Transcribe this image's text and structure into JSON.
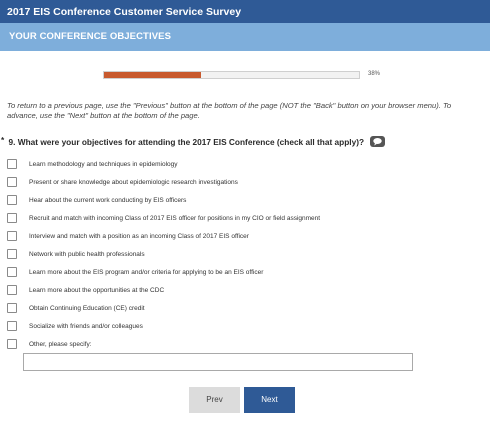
{
  "survey": {
    "title": "2017 EIS Conference Customer Service Survey",
    "page_title": "YOUR CONFERENCE OBJECTIVES"
  },
  "progress": {
    "percent": 38,
    "label": "38%",
    "fill_color": "#c85a2e"
  },
  "instructions": "To return to a previous page, use the \"Previous\" button at the bottom of the page (NOT the \"Back\" button on your browser menu). To advance, use the \"Next\" button at the bottom of the page.",
  "question": {
    "required_marker": "*",
    "text": "9. What were your objectives for attending the 2017 EIS Conference (check all that apply)?",
    "icon": "comment-icon",
    "options": [
      {
        "label": "Learn methodology and techniques in epidemiology",
        "checked": false
      },
      {
        "label": "Present or share knowledge about epidemiologic research investigations",
        "checked": false
      },
      {
        "label": "Hear about the current work conducting by EIS officers",
        "checked": false
      },
      {
        "label": "Recruit and match with incoming Class of 2017 EIS officer for positions in my CIO or field assignment",
        "checked": false
      },
      {
        "label": "Interview and match with a position as an incoming Class of 2017 EIS officer",
        "checked": false
      },
      {
        "label": "Network with public health professionals",
        "checked": false
      },
      {
        "label": "Learn more about the EIS program and/or criteria for applying to be an EIS officer",
        "checked": false
      },
      {
        "label": "Learn more about the opportunities at the CDC",
        "checked": false
      },
      {
        "label": "Obtain Continuing Education (CE) credit",
        "checked": false
      },
      {
        "label": "Socialize with friends and/or colleagues",
        "checked": false
      },
      {
        "label": "Other, please specify:",
        "checked": false
      }
    ],
    "other_value": ""
  },
  "navigation": {
    "prev_label": "Prev",
    "next_label": "Next"
  },
  "colors": {
    "header": "#2f5a96",
    "page_bar": "#7eaedb",
    "next_button": "#2f5a96",
    "prev_button": "#dcdcdc"
  }
}
